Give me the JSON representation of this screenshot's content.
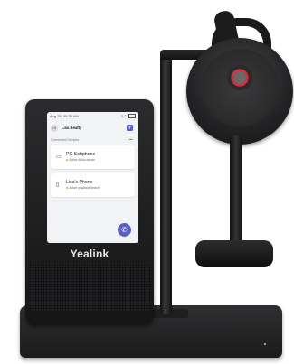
{
  "status_bar": {
    "datetime": "Aug 26, 09:35 AM",
    "icons": [
      "bluetooth-icon",
      "headset-icon",
      "battery-icon"
    ]
  },
  "user": {
    "initials": "LB",
    "name": "Lisa Beatty",
    "app_icon": "teams-icon",
    "accent": "#5a5fc8"
  },
  "section": {
    "label": "Connected Devices",
    "more_icon": "more-icon"
  },
  "devices": [
    {
      "name": "PC Softphone",
      "status": "Active Audio device",
      "icon": "laptop-icon",
      "status_color": "#e0a81b"
    },
    {
      "name": "Lisa's Phone",
      "status": "Active playback device",
      "icon": "mobile-phone-icon",
      "status_color": "#e0a81b"
    }
  ],
  "call_button_icon": "phone-icon",
  "brand": "Yealink"
}
